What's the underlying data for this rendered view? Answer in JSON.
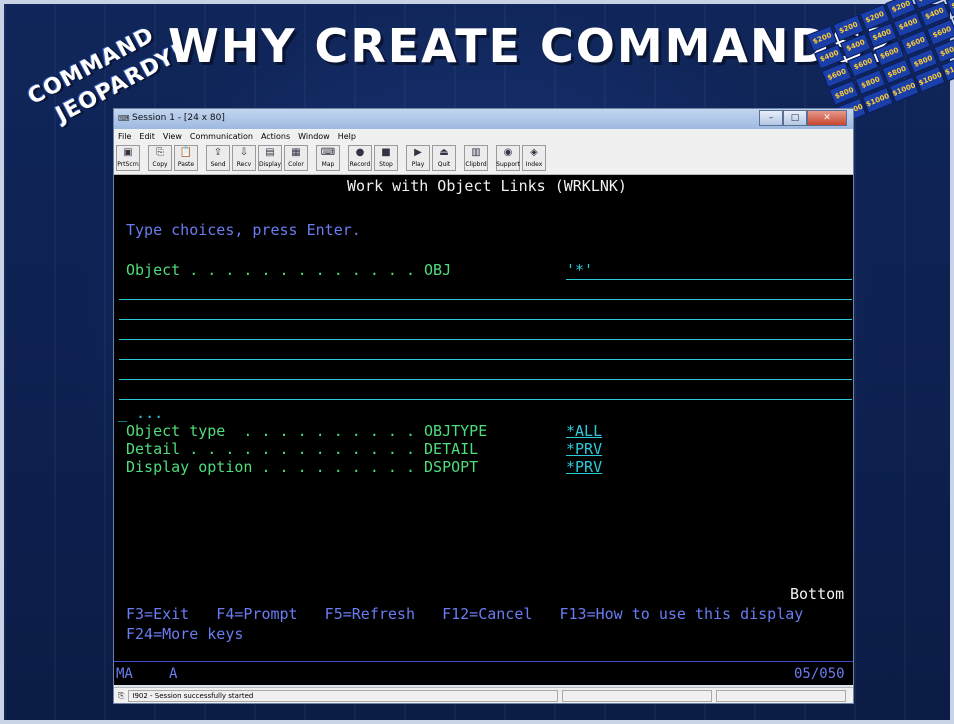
{
  "slide": {
    "logo_line1": "COMMAND",
    "logo_line2": "JEOPARDY!",
    "title": "WHY CREATE COMMANDS?",
    "board_values": [
      "$200",
      "$200",
      "$200",
      "$200",
      "$200",
      "$200",
      "$400",
      "$400",
      "$400",
      "$400",
      "$400",
      "$400",
      "$600",
      "$600",
      "$600",
      "$600",
      "$600",
      "$600",
      "$800",
      "$800",
      "$800",
      "$800",
      "$800",
      "$800",
      "$1000",
      "$1000",
      "$1000",
      "$1000",
      "$1000",
      "$1000"
    ]
  },
  "window": {
    "title": "Session 1 - [24 x 80]",
    "minimize_symbol": "–",
    "maximize_symbol": "□",
    "close_symbol": "✕",
    "menu": [
      "File",
      "Edit",
      "View",
      "Communication",
      "Actions",
      "Window",
      "Help"
    ],
    "toolbar": [
      {
        "label": "PrtScrn",
        "icon": "printer-screen-icon",
        "glyph": "▣"
      },
      {
        "label": "Copy",
        "icon": "copy-icon",
        "glyph": "⎘"
      },
      {
        "label": "Paste",
        "icon": "paste-icon",
        "glyph": "📋"
      },
      {
        "label": "Send",
        "icon": "send-icon",
        "glyph": "⇪"
      },
      {
        "label": "Recv",
        "icon": "receive-icon",
        "glyph": "⇩"
      },
      {
        "label": "Display",
        "icon": "display-icon",
        "glyph": "▤"
      },
      {
        "label": "Color",
        "icon": "color-icon",
        "glyph": "▦"
      },
      {
        "label": "Map",
        "icon": "map-icon",
        "glyph": "⌨"
      },
      {
        "label": "Record",
        "icon": "record-icon",
        "glyph": "●"
      },
      {
        "label": "Stop",
        "icon": "stop-icon",
        "glyph": "■"
      },
      {
        "label": "Play",
        "icon": "play-icon",
        "glyph": "▶"
      },
      {
        "label": "Quit",
        "icon": "quit-icon",
        "glyph": "⏏"
      },
      {
        "label": "Clipbrd",
        "icon": "clipboard-icon",
        "glyph": "▥"
      },
      {
        "label": "Support",
        "icon": "support-icon",
        "glyph": "◉"
      },
      {
        "label": "Index",
        "icon": "index-icon",
        "glyph": "◈"
      }
    ],
    "status_message": "I902 - Session successfully started",
    "status_icon_glyph": "⎘"
  },
  "terminal": {
    "heading": "Work with Object Links (WRKLNK)",
    "instruction": "Type choices, press Enter.",
    "fields": [
      {
        "label": "Object . . . . . . . . . . . . . OBJ",
        "value": "'*'"
      },
      {
        "label": "Object type  . . . . . . . . . . OBJTYPE",
        "value": "*ALL"
      },
      {
        "label": "Detail . . . . . . . . . . . . . DETAIL",
        "value": "*PRV"
      },
      {
        "label": "Display option . . . . . . . . . DSPOPT",
        "value": "*PRV"
      }
    ],
    "more_marker": "_ ...",
    "position_indicator": "Bottom",
    "function_keys_line1": "F3=Exit   F4=Prompt   F5=Refresh   F12=Cancel   F13=How to use this display",
    "function_keys_line2": "F24=More keys",
    "oia_left": "MA",
    "oia_mode": "A",
    "cursor_position": "05/050"
  },
  "colors": {
    "terminal_bg": "#000000",
    "field_label": "#4fdc7c",
    "field_value": "#2ec9d8",
    "heading": "#f2f2f2",
    "instruction": "#6a7cf2",
    "slide_bg": "#0d1f4a"
  }
}
